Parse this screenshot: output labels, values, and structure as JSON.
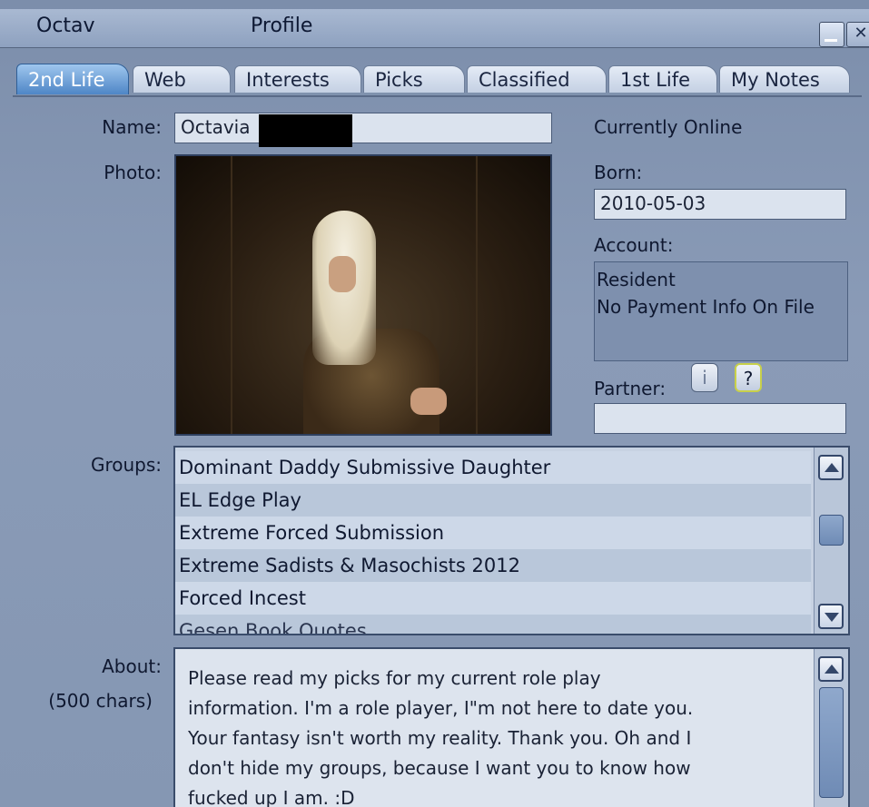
{
  "window": {
    "name": "Octav",
    "title": "Profile",
    "minimize_icon": "minimize-icon",
    "close_icon": "close-icon"
  },
  "tabs": [
    {
      "label": "2nd Life",
      "active": true
    },
    {
      "label": "Web",
      "active": false
    },
    {
      "label": "Interests",
      "active": false
    },
    {
      "label": "Picks",
      "active": false
    },
    {
      "label": "Classified",
      "active": false
    },
    {
      "label": "1st Life",
      "active": false
    },
    {
      "label": "My Notes",
      "active": false
    }
  ],
  "profile": {
    "name_label": "Name:",
    "name_value": "Octavia",
    "photo_label": "Photo:",
    "status": "Currently Online",
    "born_label": "Born:",
    "born_value": "2010-05-03",
    "account_label": "Account:",
    "account_lines": [
      "Resident",
      "No Payment Info On File"
    ],
    "partner_label": "Partner:",
    "partner_info_btn": "i",
    "partner_help_btn": "?",
    "partner_value": ""
  },
  "groups": {
    "label": "Groups:",
    "items": [
      "Dominant Daddy Submissive Daughter",
      "EL Edge Play",
      "Extreme Forced Submission",
      "Extreme Sadists & Masochists 2012",
      "Forced Incest",
      "Gesen Book Quotes"
    ]
  },
  "about": {
    "label": "About:",
    "sublabel": "(500 chars)",
    "text": "Please read my picks for my current role play\ninformation. I'm a role player, I\"m not here to date you.\nYour fantasy isn't worth my reality. Thank you. Oh and I\ndon't hide my groups, because I want you to know how\nfucked up I am. :D"
  },
  "colors": {
    "window_bg": "#8597b3",
    "tab_active": "#4e86c6",
    "field_bg": "#dbe3ee"
  }
}
